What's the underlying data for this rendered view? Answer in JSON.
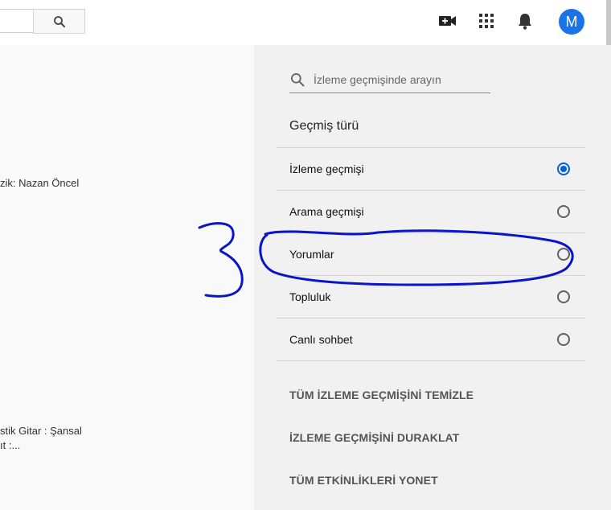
{
  "topbar": {
    "search_icon": "search-icon",
    "upload_icon": "video-camera-plus-icon",
    "apps_icon": "apps-grid-icon",
    "notifications_icon": "bell-icon",
    "avatar_letter": "M",
    "avatar_color": "#1a73e8"
  },
  "videos": {
    "item1_meta": "zik: Nazan Öncel",
    "item2_meta_line1": "stik Gitar : Şansal",
    "item2_meta_line2": "ıt :..."
  },
  "history_panel": {
    "search_placeholder": "İzleme geçmişinde arayın",
    "section_title": "Geçmiş türü",
    "types": [
      {
        "label": "İzleme geçmişi",
        "selected": true
      },
      {
        "label": "Arama geçmişi",
        "selected": false
      },
      {
        "label": "Yorumlar",
        "selected": false
      },
      {
        "label": "Topluluk",
        "selected": false
      },
      {
        "label": "Canlı sohbet",
        "selected": false
      }
    ],
    "actions": {
      "clear_all": "TÜM İZLEME GEÇMİŞİNİ TEMİZLE",
      "pause": "İZLEME GEÇMİŞİNİ DURAKLAT",
      "manage": "TÜM ETKİNLİKLERİ YONET"
    },
    "accent_color": "#065fd4"
  },
  "annotation": {
    "color": "#0a14c8"
  }
}
